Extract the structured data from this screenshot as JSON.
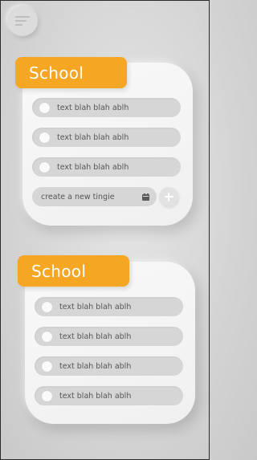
{
  "menu": {
    "icon": "menu-lines-icon"
  },
  "lists": [
    {
      "title": "School",
      "items": [
        {
          "label": "text blah blah ablh"
        },
        {
          "label": "text blah blah ablh"
        },
        {
          "label": "text blah blah ablh"
        }
      ],
      "new_item": {
        "placeholder": "create a new tingie",
        "icon": "calendar-icon",
        "add_icon": "plus-icon"
      }
    },
    {
      "title": "School",
      "items": [
        {
          "label": "text blah blah ablh"
        },
        {
          "label": "text blah blah ablh"
        },
        {
          "label": "text blah blah ablh"
        },
        {
          "label": "text blah blah ablh"
        }
      ]
    }
  ],
  "colors": {
    "accent": "#f5a623",
    "background": "#d6d6d6",
    "card": "#f5f5f5",
    "pill": "#d6d6d6",
    "text": "#555555"
  }
}
